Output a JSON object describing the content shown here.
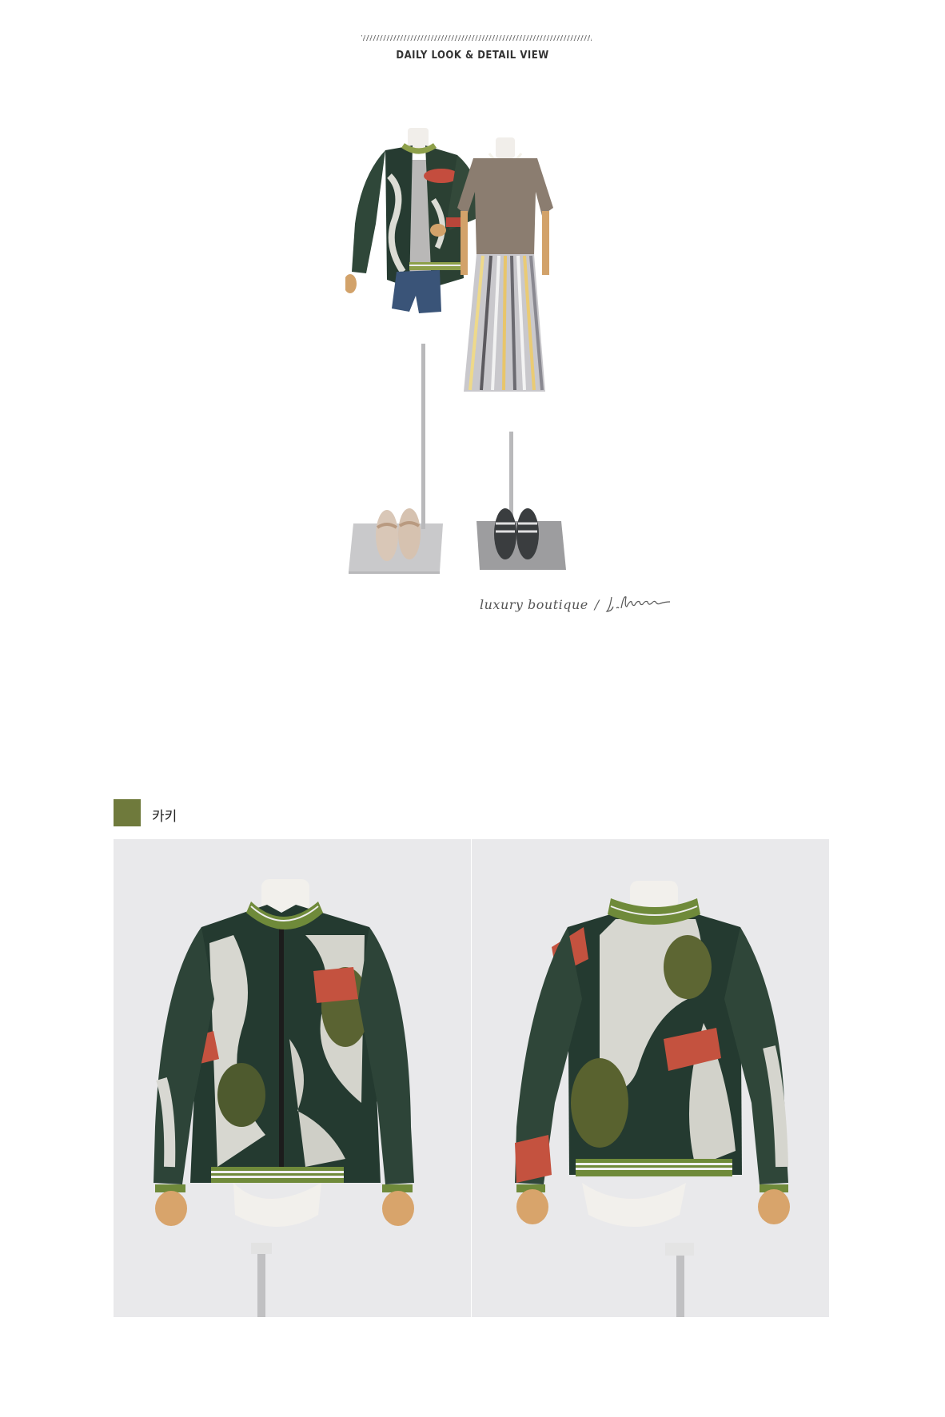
{
  "header": {
    "title": "DAILY LOOK & DETAIL VIEW"
  },
  "brand": {
    "tagline": "luxury boutique",
    "separator": "/",
    "signature": "J.blanc"
  },
  "color_option": {
    "name": "카키",
    "swatch_color": "#6f7a3c"
  },
  "images": {
    "mannequin": "mannequins-wearing-bomber-and-pleated-skirt",
    "front": "khaki-lace-bomber-jacket-front",
    "back": "khaki-lace-bomber-jacket-back"
  }
}
